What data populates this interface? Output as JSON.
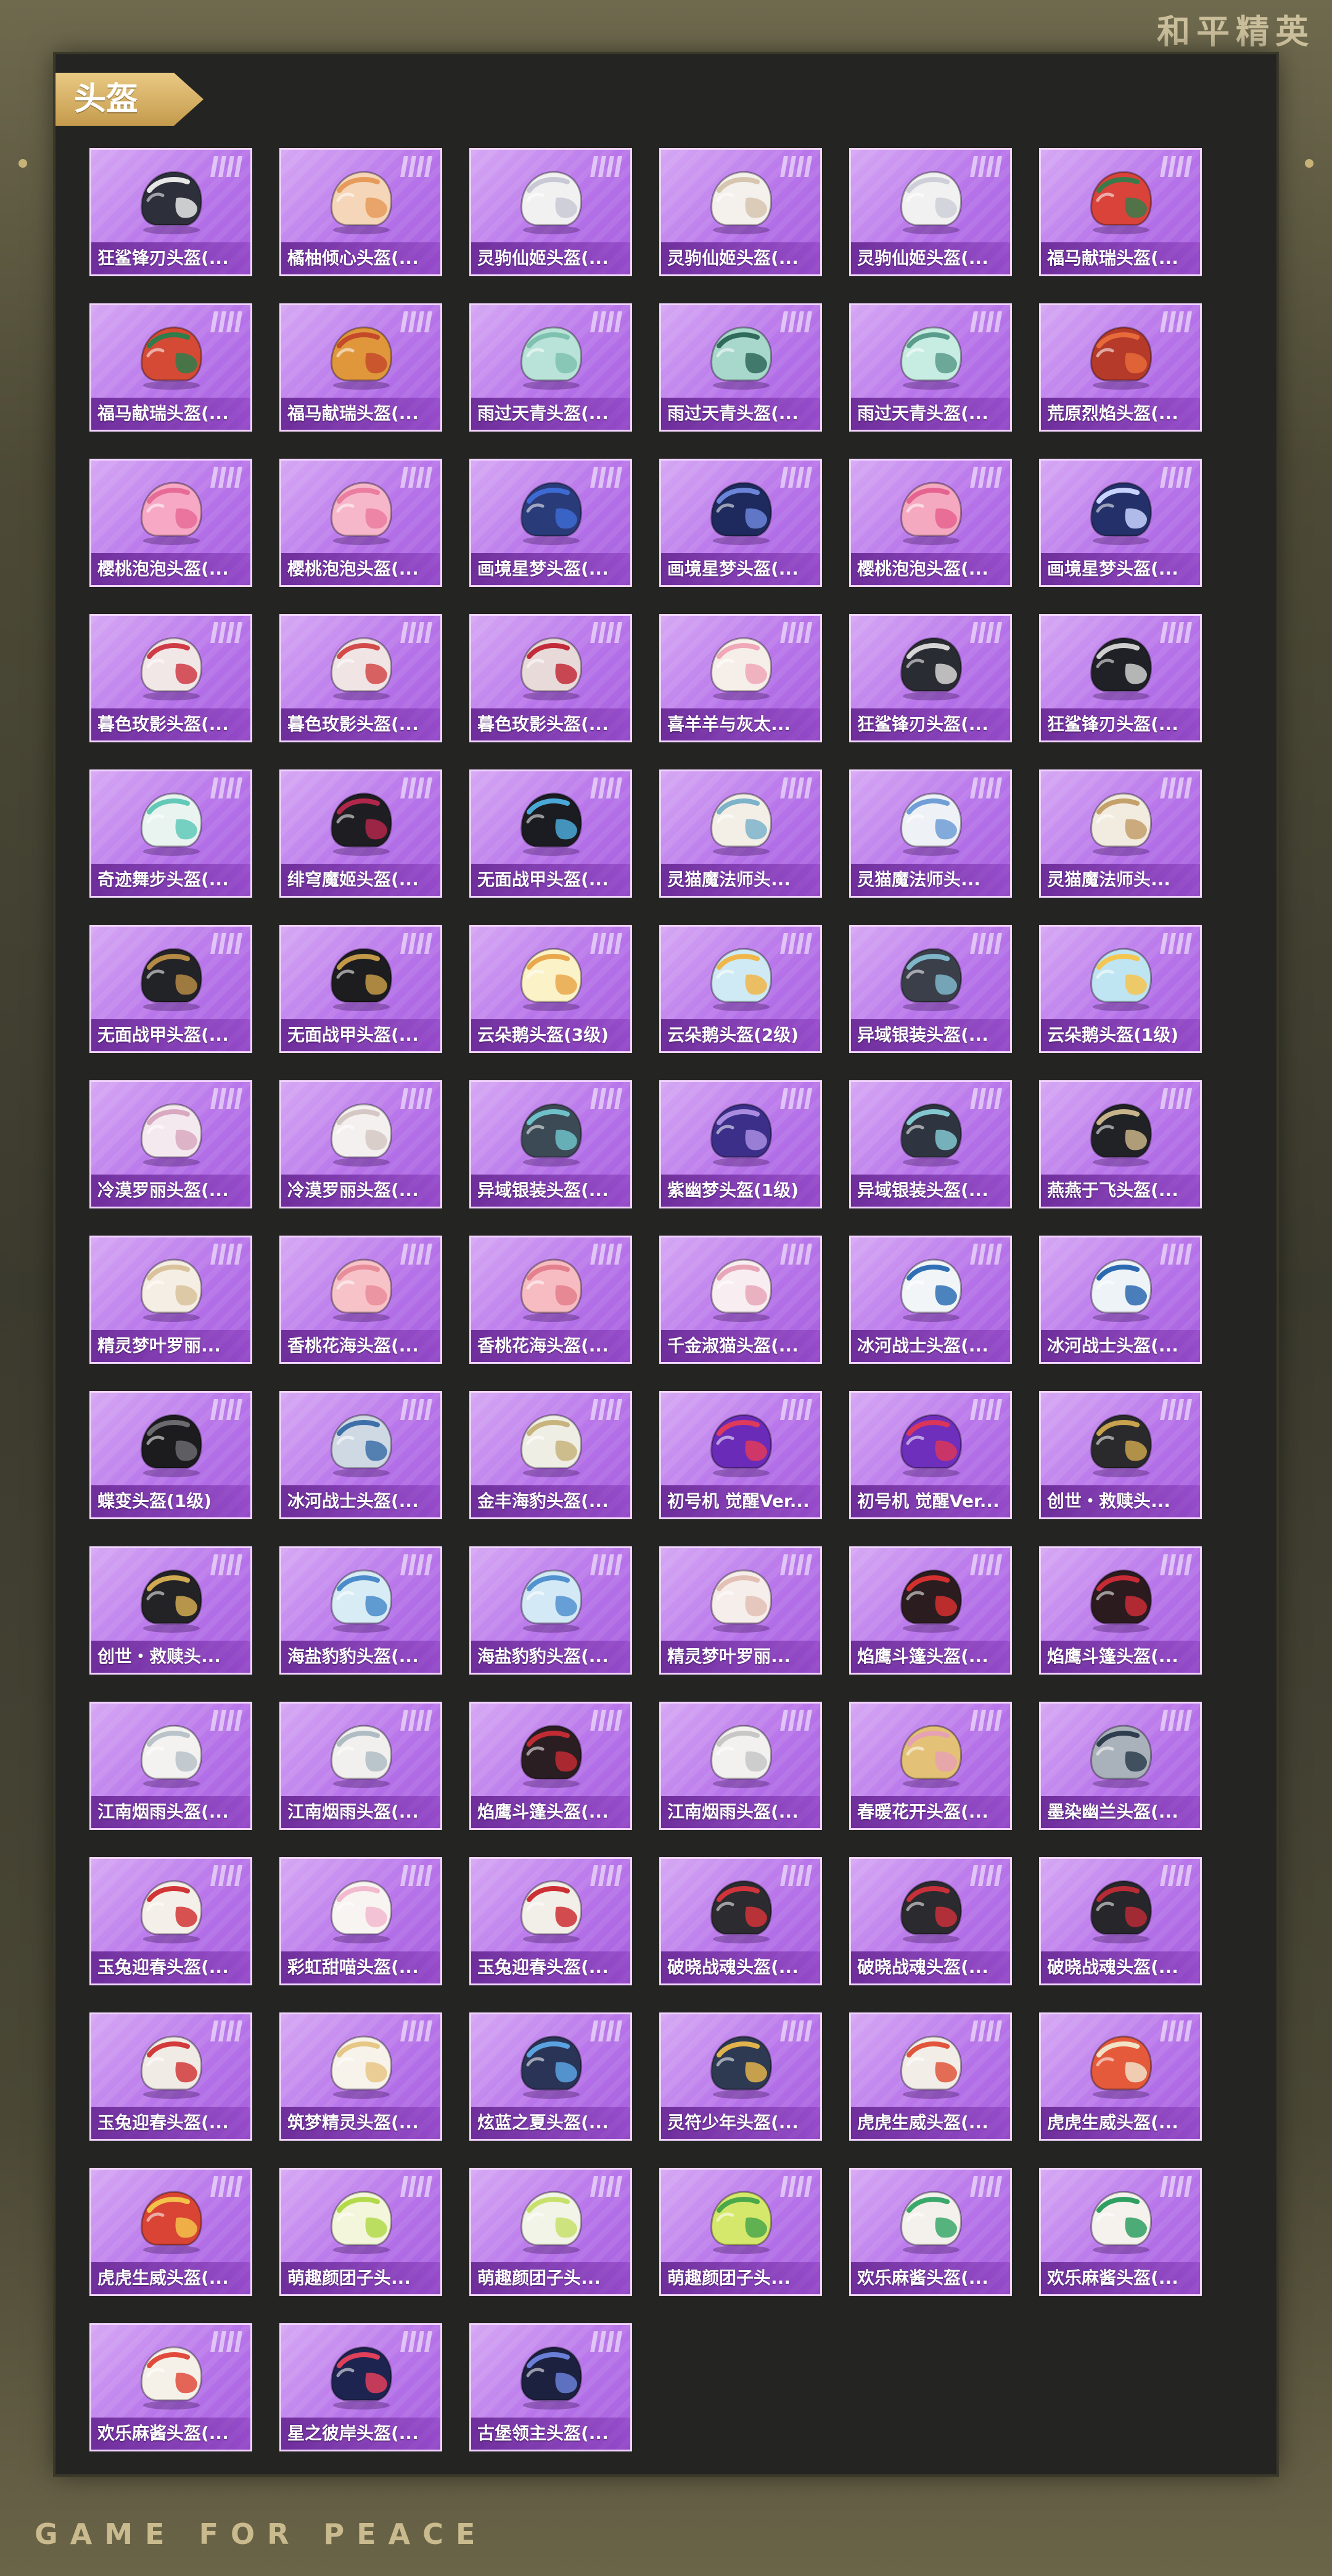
{
  "brand": "和平精英",
  "footer_brand": "GAME FOR PEACE",
  "section_title": "头盔",
  "items": [
    {
      "label": "狂鲨锋刃头盔(...",
      "color": "#2d2f3a",
      "accent": "#e7e7e7"
    },
    {
      "label": "橘柚倾心头盔(...",
      "color": "#f5d6b8",
      "accent": "#e69b5a"
    },
    {
      "label": "灵驹仙姬头盔(...",
      "color": "#f1f1f1",
      "accent": "#c9c9d6"
    },
    {
      "label": "灵驹仙姬头盔(...",
      "color": "#f4f0ec",
      "accent": "#d6c6b0"
    },
    {
      "label": "灵驹仙姬头盔(...",
      "color": "#f1f1f1",
      "accent": "#cfcfd9"
    },
    {
      "label": "福马献瑞头盔(...",
      "color": "#d9433a",
      "accent": "#3a7a4a"
    },
    {
      "label": "福马献瑞头盔(...",
      "color": "#d44a35",
      "accent": "#2f7d4a"
    },
    {
      "label": "福马献瑞头盔(...",
      "color": "#e0973c",
      "accent": "#c44a2a"
    },
    {
      "label": "雨过天青头盔(...",
      "color": "#b9e3d8",
      "accent": "#7fc1b0"
    },
    {
      "label": "雨过天青头盔(...",
      "color": "#a8d8cc",
      "accent": "#2f6a5a"
    },
    {
      "label": "雨过天青头盔(...",
      "color": "#c7ece2",
      "accent": "#5a9c8b"
    },
    {
      "label": "荒原烈焰头盔(...",
      "color": "#b53a2a",
      "accent": "#e76b3a"
    },
    {
      "label": "樱桃泡泡头盔(...",
      "color": "#f6a8c4",
      "accent": "#e66b97"
    },
    {
      "label": "樱桃泡泡头盔(...",
      "color": "#f7b7ca",
      "accent": "#ea7da0"
    },
    {
      "label": "画境星梦头盔(...",
      "color": "#2a3b7a",
      "accent": "#3d6bd3"
    },
    {
      "label": "画境星梦头盔(...",
      "color": "#1e2a5e",
      "accent": "#6b85d8"
    },
    {
      "label": "樱桃泡泡头盔(...",
      "color": "#f5a9c1",
      "accent": "#e5638f"
    },
    {
      "label": "画境星梦头盔(...",
      "color": "#24306a",
      "accent": "#c9d3ff"
    },
    {
      "label": "暮色玫影头盔(...",
      "color": "#f2e7e7",
      "accent": "#cf3b45"
    },
    {
      "label": "暮色玫影头盔(...",
      "color": "#f0e4e4",
      "accent": "#d24a4a"
    },
    {
      "label": "暮色玫影头盔(...",
      "color": "#e9dada",
      "accent": "#c22c3a"
    },
    {
      "label": "喜羊羊与灰太...",
      "color": "#f6efe9",
      "accent": "#f0a7b7"
    },
    {
      "label": "狂鲨锋刃头盔(...",
      "color": "#2a2c33",
      "accent": "#d6d6d6"
    },
    {
      "label": "狂鲨锋刃头盔(...",
      "color": "#1f2127",
      "accent": "#cfcfcf"
    },
    {
      "label": "奇迹舞步头盔(...",
      "color": "#e9f4f1",
      "accent": "#62c9b8"
    },
    {
      "label": "绯穹魔姬头盔(...",
      "color": "#1e1e22",
      "accent": "#b3264b"
    },
    {
      "label": "无面战甲头盔(...",
      "color": "#1b1c21",
      "accent": "#4aa8d8"
    },
    {
      "label": "灵猫魔法师头...",
      "color": "#f3efe6",
      "accent": "#7db3c9"
    },
    {
      "label": "灵猫魔法师头...",
      "color": "#eef1f6",
      "accent": "#6f9fd6"
    },
    {
      "label": "灵猫魔法师头...",
      "color": "#f2ece0",
      "accent": "#c4a06b"
    },
    {
      "label": "无面战甲头盔(...",
      "color": "#222327",
      "accent": "#b58a45"
    },
    {
      "label": "无面战甲头盔(...",
      "color": "#1d1d20",
      "accent": "#c49a49"
    },
    {
      "label": "云朵鹅头盔(3级)",
      "color": "#fbf2c7",
      "accent": "#e9a84b"
    },
    {
      "label": "云朵鹅头盔(2级)",
      "color": "#cfeaf4",
      "accent": "#f0b64a"
    },
    {
      "label": "异域银装头盔(...",
      "color": "#3a3f4a",
      "accent": "#7fb6c9"
    },
    {
      "label": "云朵鹅头盔(1级)",
      "color": "#bfe4f2",
      "accent": "#f5c64f"
    },
    {
      "label": "冷漠罗丽头盔(...",
      "color": "#f4e9ee",
      "accent": "#d8a9c0"
    },
    {
      "label": "冷漠罗丽头盔(...",
      "color": "#f3f0ef",
      "accent": "#d5c8c4"
    },
    {
      "label": "异域银装头盔(...",
      "color": "#3b4a55",
      "accent": "#6fc1c9"
    },
    {
      "label": "紫幽梦头盔(1级)",
      "color": "#3b2f8a",
      "accent": "#a98ce0"
    },
    {
      "label": "异域银装头盔(...",
      "color": "#2f3540",
      "accent": "#83c7d1"
    },
    {
      "label": "燕燕于飞头盔(...",
      "color": "#202226",
      "accent": "#c9b38a"
    },
    {
      "label": "精灵梦叶罗丽...",
      "color": "#f5eee4",
      "accent": "#d9c29c"
    },
    {
      "label": "香桃花海头盔(...",
      "color": "#f7c3c9",
      "accent": "#e88d9a"
    },
    {
      "label": "香桃花海头盔(...",
      "color": "#f6bcc2",
      "accent": "#e47f8d"
    },
    {
      "label": "千金淑猫头盔(...",
      "color": "#f8edf0",
      "accent": "#e8a6b8"
    },
    {
      "label": "冰河战士头盔(...",
      "color": "#f2f5f8",
      "accent": "#2e6fb5"
    },
    {
      "label": "冰河战士头盔(...",
      "color": "#eef3f8",
      "accent": "#2b69b0"
    },
    {
      "label": "蝶变头盔(1级)",
      "color": "#1c1c1f",
      "accent": "#6a6a6f"
    },
    {
      "label": "冰河战士头盔(...",
      "color": "#cfd9e4",
      "accent": "#3d6fa8"
    },
    {
      "label": "金丰海豹头盔(...",
      "color": "#efeee5",
      "accent": "#c7b47d"
    },
    {
      "label": "初号机 觉醒Ver...",
      "color": "#6a2bb8",
      "accent": "#e03a5a"
    },
    {
      "label": "初号机 觉醒Ver...",
      "color": "#6f2fbd",
      "accent": "#d9365a"
    },
    {
      "label": "创世・救赎头...",
      "color": "#2a2a2c",
      "accent": "#c9a24d"
    },
    {
      "label": "创世・救赎头...",
      "color": "#232326",
      "accent": "#d1aa52"
    },
    {
      "label": "海盐豹豹头盔(...",
      "color": "#d8ecf6",
      "accent": "#4a8cc9"
    },
    {
      "label": "海盐豹豹头盔(...",
      "color": "#d3e9f5",
      "accent": "#5292cf"
    },
    {
      "label": "精灵梦叶罗丽...",
      "color": "#f6eeea",
      "accent": "#e3c0b6"
    },
    {
      "label": "焰鹰斗篷头盔(...",
      "color": "#2a1c1f",
      "accent": "#d4302f"
    },
    {
      "label": "焰鹰斗篷头盔(...",
      "color": "#2b1b1f",
      "accent": "#c92b36"
    },
    {
      "label": "江南烟雨头盔(...",
      "color": "#f3f2f0",
      "accent": "#b9c3c9"
    },
    {
      "label": "江南烟雨头盔(...",
      "color": "#f1f0ee",
      "accent": "#b0bcc4"
    },
    {
      "label": "焰鹰斗篷头盔(...",
      "color": "#2b1e22",
      "accent": "#c12b33"
    },
    {
      "label": "江南烟雨头盔(...",
      "color": "#f3f1ef",
      "accent": "#c7c7c7"
    },
    {
      "label": "春暖花开头盔(...",
      "color": "#e3c176",
      "accent": "#e7a1b4"
    },
    {
      "label": "墨染幽兰头盔(...",
      "color": "#a9b2ba",
      "accent": "#2e3e4e"
    },
    {
      "label": "玉兔迎春头盔(...",
      "color": "#f4efe9",
      "accent": "#d13536"
    },
    {
      "label": "彩虹甜喵头盔(...",
      "color": "#f8f4f2",
      "accent": "#f2b9cf"
    },
    {
      "label": "玉兔迎春头盔(...",
      "color": "#f2eee8",
      "accent": "#cc2f34"
    },
    {
      "label": "破晓战魂头盔(...",
      "color": "#2b2b30",
      "accent": "#d1343a"
    },
    {
      "label": "破晓战魂头盔(...",
      "color": "#2a2a2f",
      "accent": "#c8303a"
    },
    {
      "label": "破晓战魂头盔(...",
      "color": "#27262b",
      "accent": "#b92c36"
    },
    {
      "label": "玉兔迎春头盔(...",
      "color": "#f1ebe6",
      "accent": "#d23a3b"
    },
    {
      "label": "筑梦精灵头盔(...",
      "color": "#f7f2ea",
      "accent": "#e6c785"
    },
    {
      "label": "炫蓝之夏头盔(...",
      "color": "#2a3456",
      "accent": "#5aa3e0"
    },
    {
      "label": "灵符少年头盔(...",
      "color": "#2d3a52",
      "accent": "#e2b34b"
    },
    {
      "label": "虎虎生威头盔(...",
      "color": "#f2ede7",
      "accent": "#e0553b"
    },
    {
      "label": "虎虎生威头盔(...",
      "color": "#e45a3b",
      "accent": "#f2e2c8"
    },
    {
      "label": "虎虎生威头盔(...",
      "color": "#d94434",
      "accent": "#f3c24a"
    },
    {
      "label": "萌趣颜团子头...",
      "color": "#f3f6da",
      "accent": "#b2d94a"
    },
    {
      "label": "萌趣颜团子头...",
      "color": "#f2f4e7",
      "accent": "#c7e06b"
    },
    {
      "label": "萌趣颜团子头...",
      "color": "#d6e86b",
      "accent": "#4aa84a"
    },
    {
      "label": "欢乐麻酱头盔(...",
      "color": "#f4f1ec",
      "accent": "#3aa86b"
    },
    {
      "label": "欢乐麻酱头盔(...",
      "color": "#f5f2ee",
      "accent": "#2f9f61"
    },
    {
      "label": "欢乐麻酱头盔(...",
      "color": "#f6f1e8",
      "accent": "#e14b3c"
    },
    {
      "label": "星之彼岸头盔(...",
      "color": "#1e2450",
      "accent": "#e0405a"
    },
    {
      "label": "古堡领主头盔(...",
      "color": "#1c2140",
      "accent": "#6a7fd8"
    }
  ]
}
